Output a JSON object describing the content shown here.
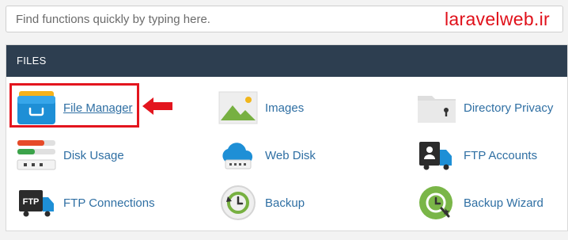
{
  "search": {
    "placeholder": "Find functions quickly by typing here."
  },
  "watermark": "laravelweb.ir",
  "panel": {
    "title": "FILES"
  },
  "items": [
    {
      "label": "File Manager",
      "icon": "file-manager-icon"
    },
    {
      "label": "Images",
      "icon": "images-icon"
    },
    {
      "label": "Directory Privacy",
      "icon": "directory-privacy-icon"
    },
    {
      "label": "Disk Usage",
      "icon": "disk-usage-icon"
    },
    {
      "label": "Web Disk",
      "icon": "web-disk-icon"
    },
    {
      "label": "FTP Accounts",
      "icon": "ftp-accounts-icon"
    },
    {
      "label": "FTP Connections",
      "icon": "ftp-connections-icon"
    },
    {
      "label": "Backup",
      "icon": "backup-icon"
    },
    {
      "label": "Backup Wizard",
      "icon": "backup-wizard-icon"
    }
  ],
  "icon_text": {
    "ftp": "FTP"
  },
  "colors": {
    "header": "#2d3e50",
    "link": "#2f6fa3",
    "highlight": "#e3151e",
    "watermark": "#e0101a"
  }
}
